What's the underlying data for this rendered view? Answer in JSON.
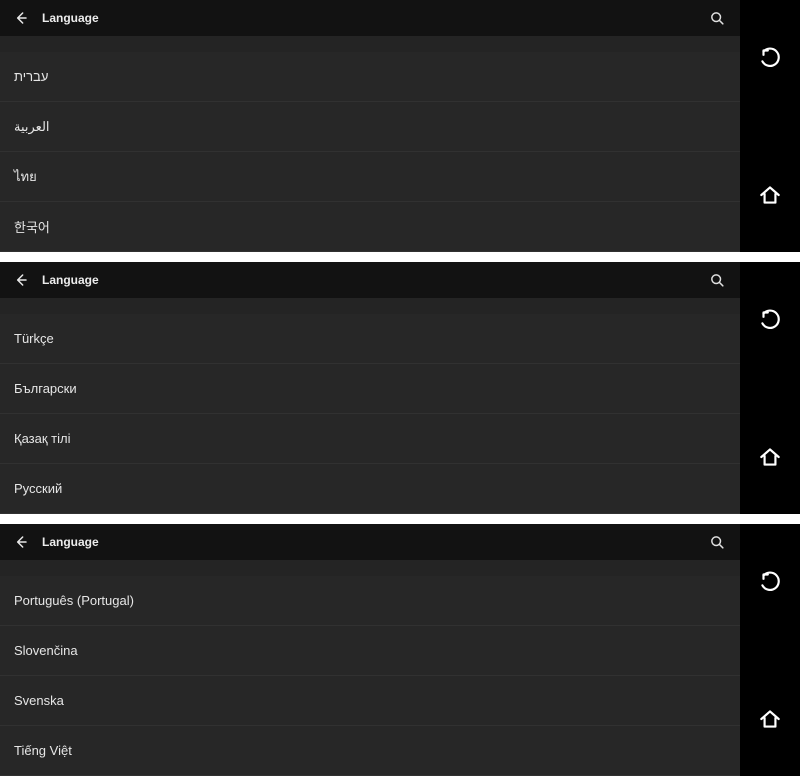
{
  "header": {
    "title": "Language"
  },
  "icons": {
    "back_arrow": "back-arrow-icon",
    "search": "search-icon",
    "undo": "undo-icon",
    "home": "home-icon"
  },
  "panels": [
    {
      "items": [
        "עברית",
        "العربية",
        "ไทย",
        "한국어"
      ]
    },
    {
      "items": [
        "Türkçe",
        "Български",
        "Қазақ тілі",
        "Русский"
      ]
    },
    {
      "items": [
        "Português (Portugal)",
        "Slovenčina",
        "Svenska",
        "Tiếng Việt"
      ]
    }
  ]
}
